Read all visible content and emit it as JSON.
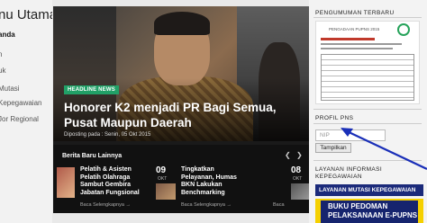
{
  "sidebar": {
    "title": "nu Utama",
    "items": [
      {
        "label": "anda",
        "active": true
      },
      {
        "label": "n"
      },
      {
        "label": "uk"
      },
      {
        "label": "Mutasi"
      },
      {
        "label": "Kepegawaian"
      },
      {
        "label": "Jor Regional"
      },
      {
        "label": "l"
      }
    ]
  },
  "hero": {
    "tag": "HEADLINE NEWS",
    "headline": "Honorer K2 menjadi PR Bagi Semua, Pusat Maupun Daerah",
    "posted": "Diposting pada : Senin, 05 Okt 2015"
  },
  "news_bar": {
    "label": "Berita Baru Lainnya",
    "prev": "❮",
    "next": "❯",
    "items": [
      {
        "line1": "Pelatih & Asisten",
        "line2": "Pelatih Olahraga",
        "line3": "Sambut Gembira",
        "line4": "Jabatan Fungsional",
        "readmore": "Baca Selengkapnya →"
      },
      {
        "day": "09",
        "month": "OKT",
        "line1": "Tingkatkan",
        "line2": "Pelayanan, Humas",
        "line3": "BKN Lakukan",
        "line4": "Benchmarking",
        "readmore": "Baca Selengkapnya →"
      },
      {
        "day": "08",
        "month": "OKT",
        "readmore": "Baca"
      }
    ]
  },
  "right": {
    "announce_title": "PENGUMUMAN TERBARU",
    "doc_title": "PENGADAAN PUPNS 2015",
    "profile_title": "PROFIL PNS",
    "nip_placeholder": "NIP",
    "show_button": "Tampilkan",
    "info_title_line1": "LAYANAN INFORMASI",
    "info_title_line2": "KEPEGAWAIAN",
    "banner_mutasi": "LAYANAN MUTASI KEPEGAWAIAN",
    "banner_book_line1": "BUKU PEDOMAN",
    "banner_book_line2": "PELAKSANAAN E-PUPNS"
  },
  "colors": {
    "tag_green": "#21a067",
    "banner_blue": "#1b2a7a",
    "banner_yellow": "#f5d000",
    "arrow_blue": "#1a2fb8"
  }
}
